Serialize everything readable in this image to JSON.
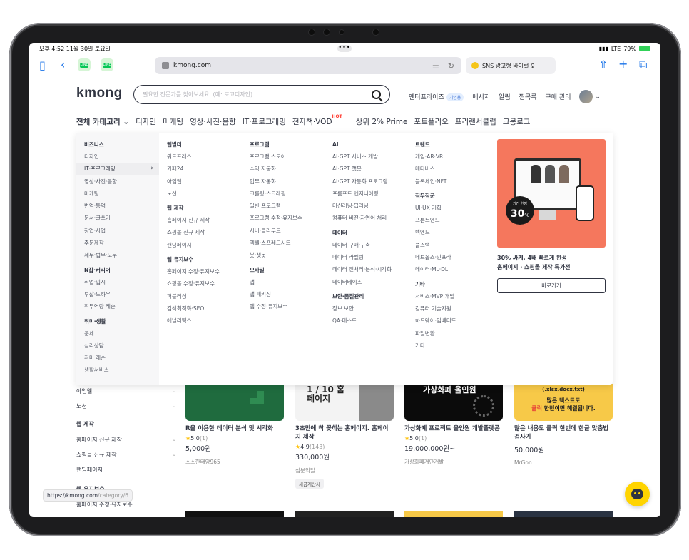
{
  "status": {
    "time_date": "오후 4:52  11월 30일 토요일",
    "dots": "•••",
    "network": "LTE",
    "battery_pct": "79%"
  },
  "browser": {
    "url": "kmong.com",
    "tab_title": "SNS 광고형 바이럴 ♀"
  },
  "header": {
    "logo": "kmong",
    "search_placeholder": "필요한 전문가를 찾아보세요. (예: 로고디자인)",
    "enterprise": "엔터프라이즈",
    "enterprise_badge": "기업용",
    "messages": "메시지",
    "alerts": "알림",
    "wishlist": "찜목록",
    "purchases": "구매 관리"
  },
  "catbar": {
    "all": "전체 카테고리",
    "items": [
      "디자인",
      "마케팅",
      "영상·사진·음향",
      "IT·프로그래밍",
      "전자책·VOD"
    ],
    "hot": "HOT",
    "items2": [
      "상위 2% Prime",
      "포트폴리오",
      "프리랜서클럽",
      "크몽로그"
    ]
  },
  "menu": {
    "left": [
      {
        "title": "비즈니스",
        "items": [
          "디자인",
          "IT·프로그래밍",
          "영상·사진·음향",
          "마케팅",
          "번역·통역",
          "문서·글쓰기",
          "창업·사업",
          "주문제작",
          "세무·법무·노무"
        ]
      },
      {
        "title": "N잡·커리어",
        "items": [
          "취업·입시",
          "투잡·노하우",
          "직무역량 레슨"
        ]
      },
      {
        "title": "취미·생활",
        "items": [
          "운세",
          "심리상담",
          "취미 레슨",
          "생활서비스"
        ]
      }
    ],
    "col1": [
      {
        "title": "웹빌더",
        "items": [
          "워드프레스",
          "카페24",
          "아임웹",
          "노션"
        ]
      },
      {
        "title": "웹 제작",
        "items": [
          "홈페이지 신규 제작",
          "쇼핑몰 신규 제작",
          "랜딩페이지"
        ]
      },
      {
        "title": "웹 유지보수",
        "items": [
          "홈페이지 수정·유지보수",
          "쇼핑몰 수정·유지보수",
          "퍼블리싱",
          "검색최적화·SEO",
          "애널리틱스"
        ]
      }
    ],
    "col2": [
      {
        "title": "프로그램",
        "items": [
          "프로그램 스토어",
          "수익 자동화",
          "업무 자동화",
          "크롤링·스크래핑",
          "일반 프로그램",
          "프로그램 수정·유지보수",
          "서버·클라우드",
          "엑셀·스프레드시트",
          "봇·챗봇"
        ]
      },
      {
        "title": "모바일",
        "items": [
          "앱",
          "앱 패키징",
          "앱 수정·유지보수"
        ]
      }
    ],
    "col3": [
      {
        "title": "AI",
        "items": [
          "AI·GPT 서비스 개발",
          "AI·GPT 챗봇",
          "AI·GPT 자동화 프로그램",
          "프롬프트 엔지니어링",
          "머신러닝·딥러닝",
          "컴퓨터 비전·자연어 처리"
        ]
      },
      {
        "title": "데이터",
        "items": [
          "데이터 구매·구축",
          "데이터 라벨링",
          "데이터 전처리·분석·시각화",
          "데이터베이스"
        ]
      },
      {
        "title": "보안·품질관리",
        "items": [
          "정보 보안",
          "QA·테스트"
        ]
      }
    ],
    "col4": [
      {
        "title": "트렌드",
        "items": [
          "게임·AR·VR",
          "메타버스",
          "블록체인·NFT"
        ]
      },
      {
        "title": "직무직군",
        "items": [
          "UI·UX 기획",
          "프론트엔드",
          "백엔드",
          "풀스택",
          "데브옵스·인프라",
          "데이터·ML·DL"
        ]
      },
      {
        "title": "기타",
        "items": [
          "서비스·MVP 개발",
          "컴퓨터 기술지원",
          "하드웨어·임베디드",
          "파일변환",
          "기타"
        ]
      }
    ],
    "promo": {
      "badge_small": "기간 한정",
      "badge_big": "30",
      "badge_pct": "%",
      "line1": "30% 싸게, 4배 빠르게 완성",
      "line2": "홈페이지 · 쇼핑몰 제작 특가전",
      "button": "바로가기"
    }
  },
  "sidebar_bg": {
    "items_a": [
      "아임웹",
      "노션"
    ],
    "head": "웹 제작",
    "items_b": [
      "홈페이지 신규 제작",
      "쇼핑몰 신규 제작",
      "랜딩페이지"
    ],
    "head2": "웹 유지보수",
    "items_c": [
      "홈페이지 수정·유지보수"
    ]
  },
  "cards": [
    {
      "title": "R을 이용한 데이터 분석 및 시각화",
      "rating": "5.0",
      "count": "(1)",
      "price": "5,000원",
      "seller": "소소한태양965",
      "tag": "",
      "thumb_text": ""
    },
    {
      "title": "3초만에 착 꽂히는 홈페이지. 홈페이지 제작",
      "rating": "4.9",
      "count": "(143)",
      "price": "330,000원",
      "seller": "심분의일",
      "tag": "세금계산서",
      "thumb_text": "1 / 10 홈페이지"
    },
    {
      "title": "가상화폐 프로젝트 올인원 개발플랫폼",
      "rating": "5.0",
      "count": "(1)",
      "price": "19,000,000원~",
      "seller": "가상화폐개단개발",
      "tag": "",
      "thumb_text": "가상화폐 올인원"
    },
    {
      "title": "많은 내용도 클릭 한번에 한글 맞춤법 검사기",
      "rating": "",
      "count": "",
      "price": "50,000원",
      "seller": "MrGon",
      "tag": "",
      "thumb_text": "(.xlsx.docx.txt)",
      "thumb_line2": "많은 텍스트도",
      "thumb_line3a": "클릭",
      "thumb_line3b": " 한번이면 해결됩니다."
    }
  ],
  "tooltip": {
    "main": "https://kmong.com",
    "path": "/category/6"
  },
  "colors": {
    "brand": "#303441",
    "promo_bg": "#f5775d",
    "chat": "#ffd400",
    "line_green": "#06c755"
  }
}
